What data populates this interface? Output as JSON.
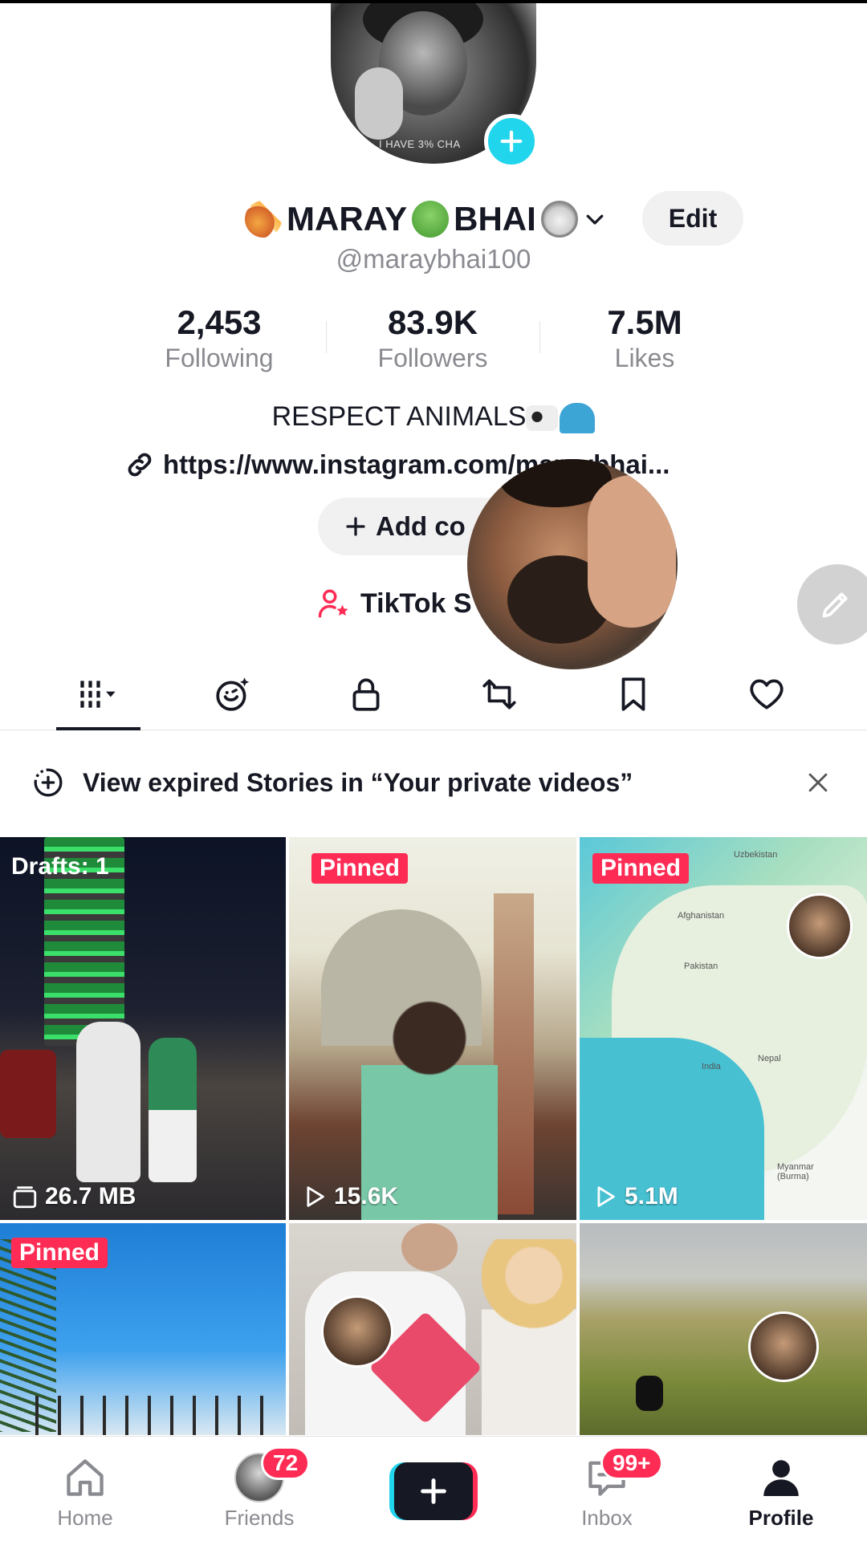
{
  "profile": {
    "display_name": "MARAY",
    "display_name_suffix": "BHAI",
    "username": "@maraybhai100",
    "avatar_caption": "I HAVE 3% CHA",
    "edit_label": "Edit",
    "stats": {
      "following": {
        "value": "2,453",
        "label": "Following"
      },
      "followers": {
        "value": "83.9K",
        "label": "Followers"
      },
      "likes": {
        "value": "7.5M",
        "label": "Likes"
      }
    },
    "bio": "RESPECT ANIMALS",
    "link": "https://www.instagram.com/maraybhai...",
    "add_collab_label": "Add co",
    "studio_label": "TikTok S"
  },
  "tabs": {
    "icons": [
      "videos-grid-icon",
      "emoji-sparkle-icon",
      "lock-icon",
      "repost-icon",
      "bookmark-icon",
      "heart-icon"
    ],
    "active": "videos-grid-icon"
  },
  "banner": {
    "text": "View expired Stories in “Your private videos”"
  },
  "grid": {
    "items": [
      {
        "overlay": "Drafts: 1",
        "meta": "26.7 MB",
        "meta_icon": "drafts-icon"
      },
      {
        "badge": "Pinned",
        "meta": "15.6K",
        "meta_icon": "play-icon"
      },
      {
        "badge": "Pinned",
        "meta": "5.1M",
        "meta_icon": "play-icon",
        "map_labels": [
          "Uzbekistan",
          "Afghanistan",
          "Pakistan",
          "India",
          "Nepal",
          "Myanmar (Burma)"
        ]
      },
      {
        "badge": "Pinned"
      },
      {},
      {}
    ]
  },
  "bottom_nav": {
    "home": "Home",
    "friends": "Friends",
    "friends_badge": "72",
    "inbox": "Inbox",
    "inbox_badge": "99+",
    "profile": "Profile"
  },
  "colors": {
    "accent_red": "#fe2c55",
    "accent_cyan": "#20d5ec",
    "text_primary": "#161823",
    "text_secondary": "#8a8b91"
  }
}
